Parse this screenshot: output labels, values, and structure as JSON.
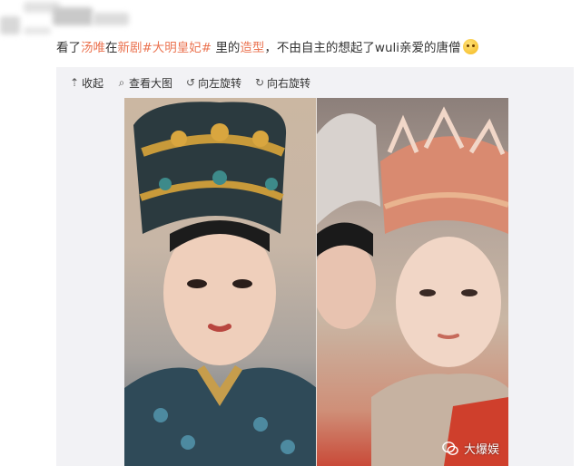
{
  "post": {
    "text_prefix": "看了",
    "person_link": "汤唯",
    "text_mid": "在",
    "new_drama_link": "新剧",
    "topic_link": "#大明皇妃#",
    "text_mid2": " 里的",
    "styling_link": "造型",
    "text_suffix": "，不由自主的想起了wuli亲爱的唐僧",
    "emoji_icon": "thinking-face-emoji"
  },
  "toolbar": {
    "collapse_label": "收起",
    "view_large_label": "查看大图",
    "rotate_left_label": "向左旋转",
    "rotate_right_label": "向右旋转"
  },
  "photo": {
    "watermark_text": "大爆娱"
  },
  "colors": {
    "link": "#eb7350",
    "panel_bg": "#f2f2f5",
    "text": "#333333"
  }
}
